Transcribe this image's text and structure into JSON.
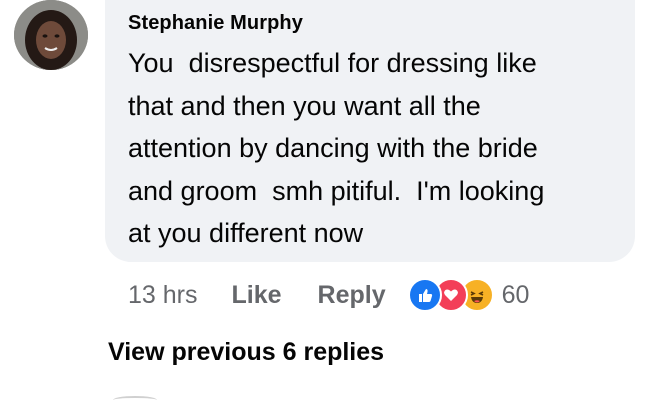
{
  "comment": {
    "author": "Stephanie Murphy",
    "text": "You  disrespectful for dressing like\nthat and then you want all the\nattention by dancing with the bride\nand groom  smh pitiful.  I'm looking\nat you different now"
  },
  "actions": {
    "timestamp": "13 hrs",
    "like_label": "Like",
    "reply_label": "Reply",
    "reaction_icons": [
      "like-icon",
      "love-icon",
      "haha-icon"
    ],
    "reaction_count": "60"
  },
  "replies": {
    "view_previous_label": "View previous 6 replies"
  },
  "colors": {
    "bubble": "#f0f2f5",
    "meta_text": "#65676b",
    "like_blue": "#1877f2",
    "love_red": "#f33e58",
    "haha_yellow": "#f7b125"
  }
}
